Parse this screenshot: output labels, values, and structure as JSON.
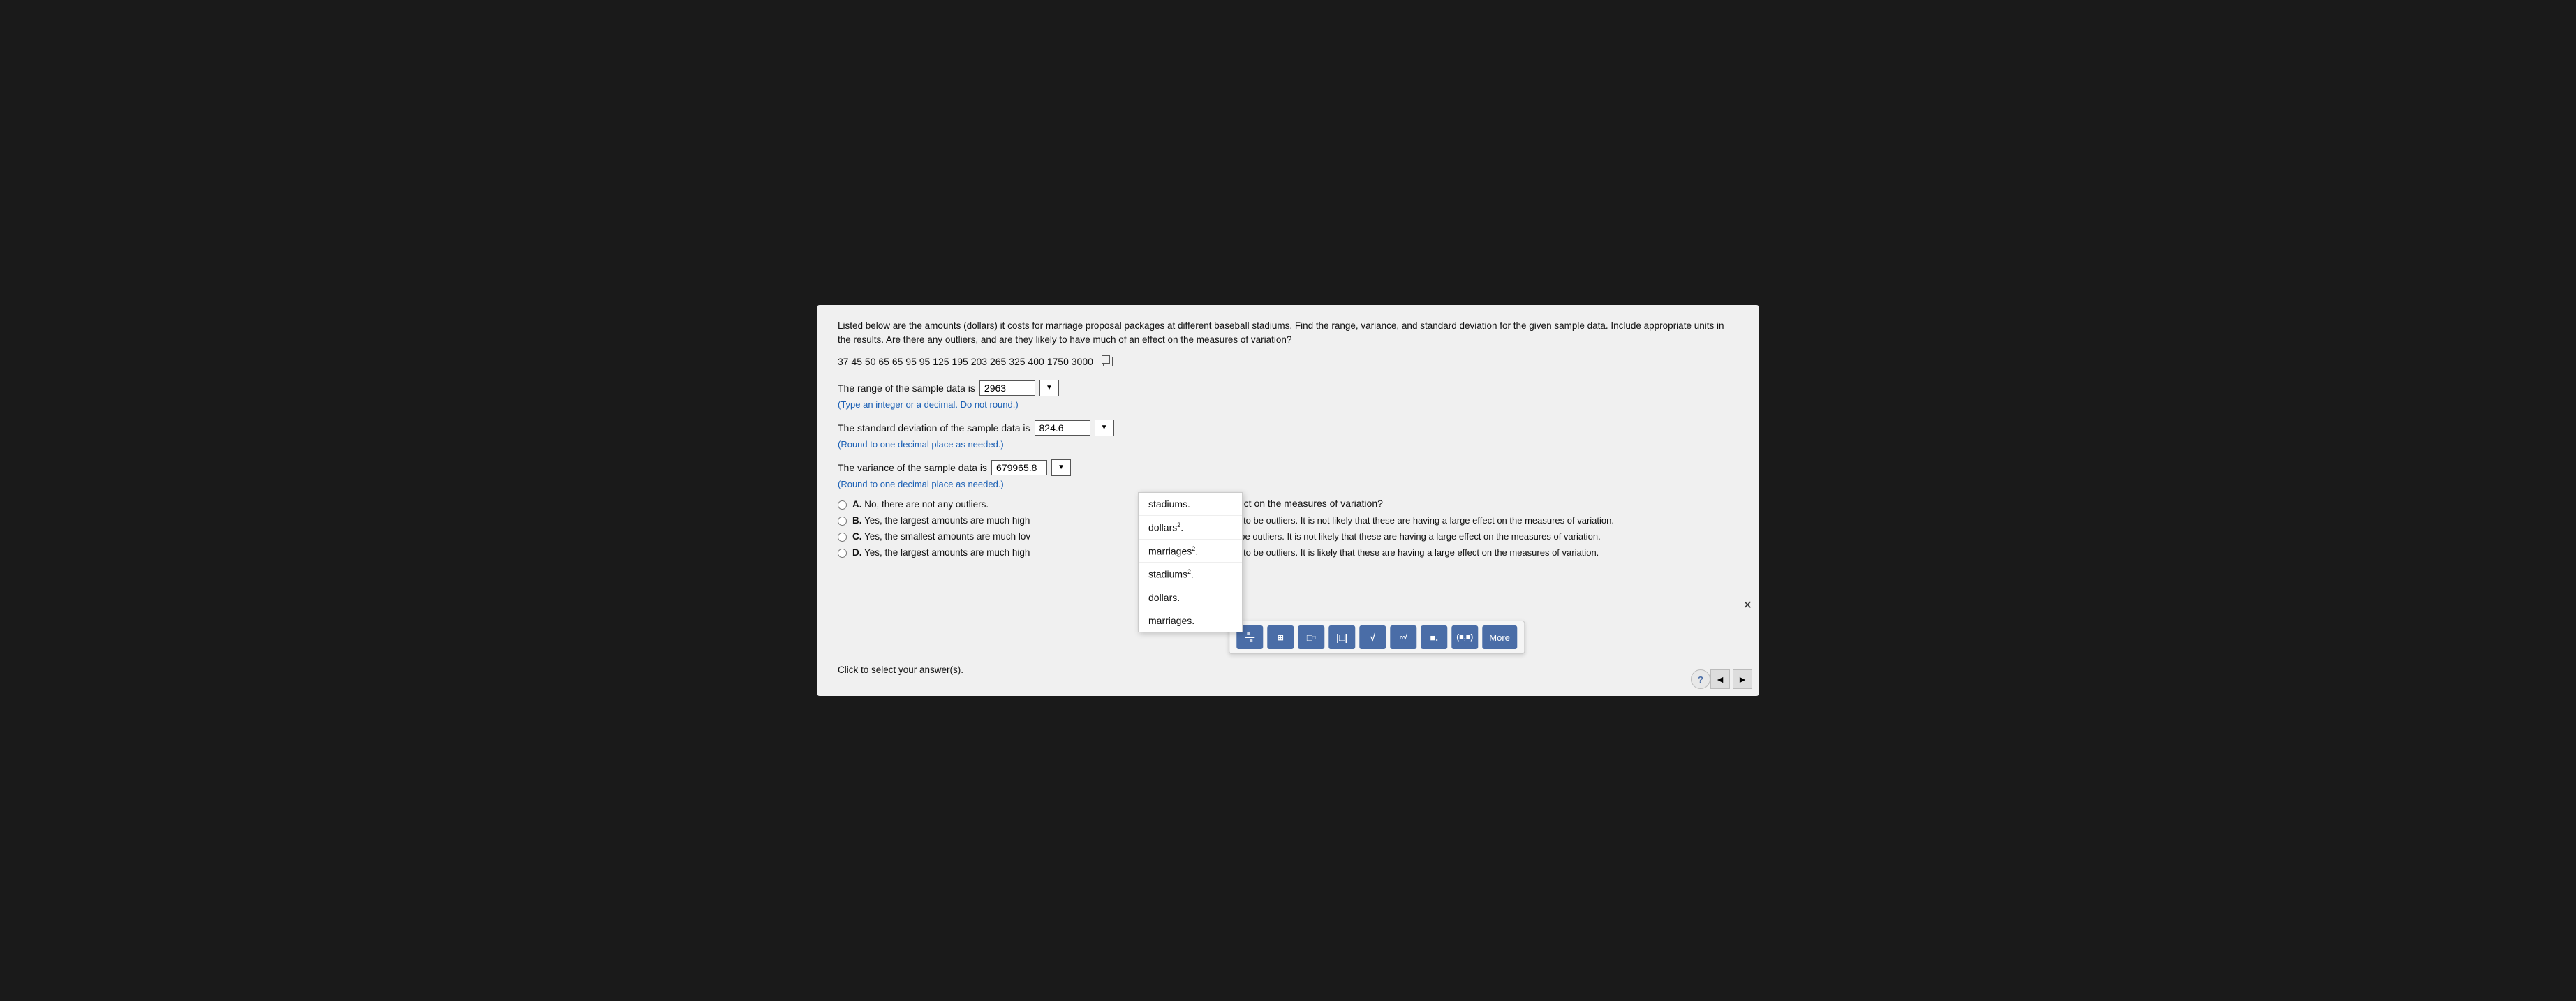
{
  "problem": {
    "description": "Listed below are the amounts (dollars) it costs for marriage proposal packages at different baseball stadiums. Find the range, variance, and standard deviation for the given sample data. Include appropriate units in the results. Are there any outliers, and are they likely to have much of an effect on the measures of variation?",
    "data_values": "37   45   50   65   65   95   95   125   195   203   265   325   400   1750   3000",
    "range_label": "The range of the sample data is",
    "range_value": "2963",
    "range_hint": "(Type an integer or a decimal. Do not round.)",
    "std_label": "The standard deviation of the sample data is",
    "std_value": "824.6",
    "std_hint": "(Round to one decimal place as needed.)",
    "variance_label": "The variance of the sample data is",
    "variance_value": "679965.8",
    "variance_hint": "(Round to one decimal place as needed.)",
    "outlier_question": "Are there any outliers and, if so, are they likely to have much of an effect on the measures of variation?",
    "options": [
      {
        "letter": "A.",
        "text": "No, there are not any outliers."
      },
      {
        "letter": "B.",
        "text": "Yes, the largest amounts are much high"
      },
      {
        "letter": "C.",
        "text": "Yes, the smallest amounts are much lov"
      },
      {
        "letter": "D.",
        "text": "Yes, the largest amounts are much high"
      }
    ],
    "option_continuations": [
      "",
      "data, and appear to be outliers. It is not likely that these are having a large effect on the measures of variation.",
      "data, and appear to be outliers. It is not likely that these are having a large effect on the measures of variation.",
      "data, and appear to be outliers. It is likely that these are having a large effect on the measures of variation."
    ],
    "click_to_select": "Click to select your answer(s)."
  },
  "dropdown": {
    "items": [
      "stadiums.",
      "dollars².",
      "marriages².",
      "stadiums².",
      "dollars.",
      "marriages."
    ]
  },
  "toolbar": {
    "more_label": "More",
    "buttons": [
      "fraction",
      "matrix",
      "superscript",
      "absolute",
      "sqrt",
      "nth-root",
      "decimal",
      "ordered-pair"
    ]
  }
}
